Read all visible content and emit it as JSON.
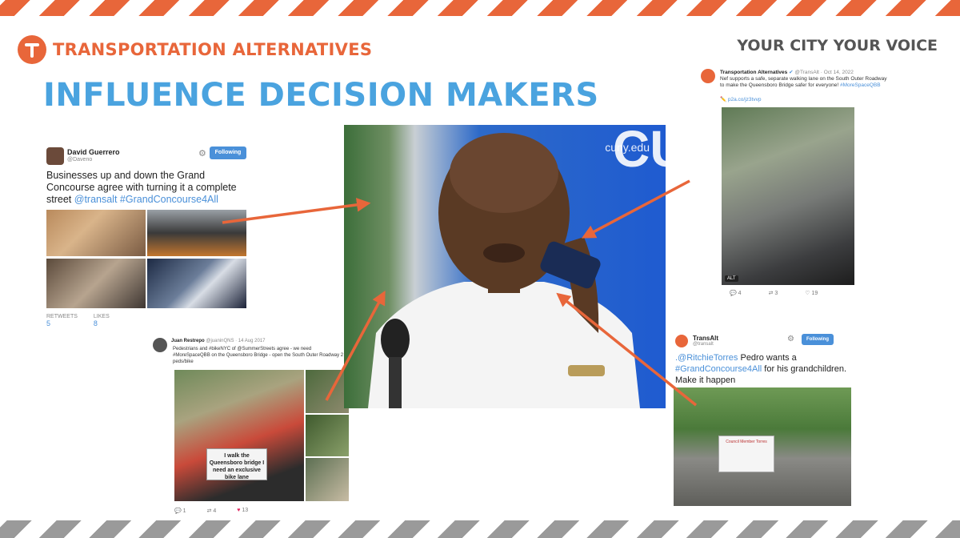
{
  "brand": {
    "name": "TRANSPORTATION ALTERNATIVES",
    "tagline": "YOUR CITY YOUR VOICE",
    "accent": "#e8663a",
    "headline_color": "#4aa3df"
  },
  "headline": "INFLUENCE DECISION MAKERS",
  "center_photo": {
    "sign_text": "cuny.edu",
    "sign_letters": "CUNY",
    "side_text": "cu"
  },
  "tweet1": {
    "name": "David Guerrero",
    "handle": "@Daveno",
    "follow_label": "Following",
    "text_plain": "Businesses up and down the Grand Concourse agree with turning it a complete street ",
    "mention": "@transalt",
    "hashtag": "#GrandConcourse4All",
    "retweets_label": "RETWEETS",
    "retweets": "5",
    "likes_label": "LIKES",
    "likes": "8"
  },
  "tweet2": {
    "name": "Juan Restrepo",
    "handle": "@juaninQNS · 14 Aug 2017",
    "text": "Pedestrians and #bikeNYC of @SummerStreets agree - we need #MoreSpaceQBB on the Queensboro Bridge - open the South Outer Roadway 2 peds/bike",
    "sign_text": "I walk the Queensboro bridge I need an exclusive bike lane",
    "replies": "1",
    "retweets": "4",
    "likes": "13"
  },
  "tweet3": {
    "name": "Transportation Alternatives",
    "handle": "@TransAlt · Oct 14, 2022",
    "text": "Nef supports a safe, separate walking lane on the South Outer Roadway to make the Queensboro Bridge safer for everyone! ",
    "hashtag": "#MoreSpaceQBB",
    "link": "p2a.co/jz3tvvp",
    "badge": "ALT",
    "replies": "4",
    "retweets": "3",
    "likes": "19"
  },
  "tweet4": {
    "name": "TransAlt",
    "handle": "@transalt",
    "follow_label": "Following",
    "mention": ".@RitchieTorres",
    "text_mid": " Pedro wants a ",
    "hashtag": "#GrandConcourse4All",
    "text_end": " for his grandchildren. Make it happen",
    "sign_text": "Council Member Torres"
  },
  "arrow_color": "#e8663a"
}
